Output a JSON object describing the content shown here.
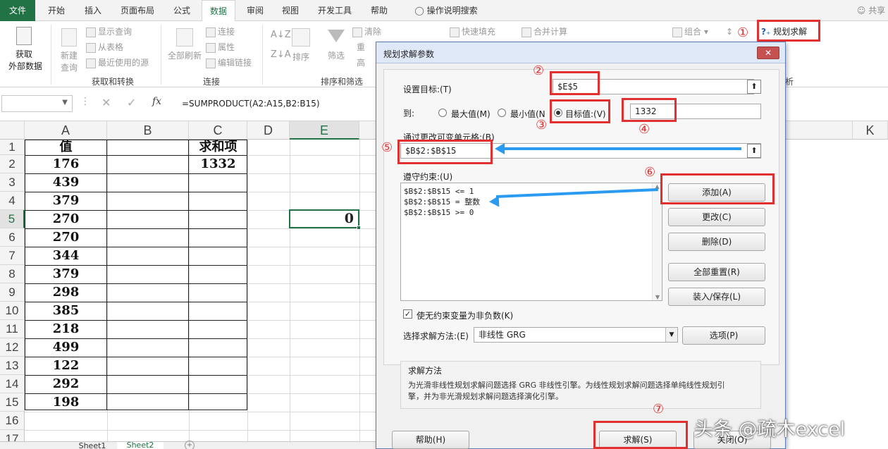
{
  "ribbon": {
    "tabs": [
      "文件",
      "开始",
      "插入",
      "页面布局",
      "公式",
      "数据",
      "审阅",
      "视图",
      "开发工具",
      "帮助",
      "操作说明搜索"
    ],
    "active_tab": "数据",
    "share": "共享",
    "get_external_data_1": "获取",
    "get_external_data_2": "外部数据",
    "new_query_1": "新建",
    "new_query_2": "查询",
    "show_queries": "显示查询",
    "from_table": "从表格",
    "recent_sources": "最近使用的源",
    "group_get_transform": "获取和转换",
    "refresh_all": "全部刷新",
    "connections": "连接",
    "properties": "属性",
    "edit_links": "编辑链接",
    "group_connections": "连接",
    "sort": "排序",
    "filter": "筛选",
    "clear": "清除",
    "reapply": "重",
    "advanced": "高",
    "group_sort_filter": "排序和筛选",
    "flash_fill": "快速填充",
    "consolidate": "合并计算",
    "group_outline": "组合",
    "solver": "规划求解",
    "analysis": "析"
  },
  "formula_bar": {
    "formula": "=SUMPRODUCT(A2:A15,B2:B15)"
  },
  "grid": {
    "columns": [
      "A",
      "B",
      "C",
      "D",
      "E",
      "K"
    ],
    "rows": [
      "1",
      "2",
      "3",
      "4",
      "5",
      "6",
      "7",
      "8",
      "9",
      "10",
      "11",
      "12",
      "13",
      "14",
      "15",
      "16",
      "17"
    ],
    "a_header": "值",
    "c_header": "求和项",
    "values": [
      "176",
      "439",
      "379",
      "270",
      "270",
      "344",
      "379",
      "298",
      "385",
      "218",
      "499",
      "122",
      "292",
      "198"
    ],
    "c2": "1332",
    "e5": "0"
  },
  "sheets": [
    "Sheet1",
    "Sheet2"
  ],
  "dialog": {
    "title": "规划求解参数",
    "set_objective_label": "设置目标:(T)",
    "set_objective_value": "$E$5",
    "to_label": "到:",
    "opt_max": "最大值(M)",
    "opt_min": "最小值(N",
    "opt_value": "目标值:(V)",
    "target_value": "1332",
    "changing_cells_label": "通过更改可变单元格:(B)",
    "changing_cells_value": "$B$2:$B$15",
    "constraints_label": "遵守约束:(U)",
    "constraints": [
      "$B$2:$B$15 <= 1",
      "$B$2:$B$15 = 整数",
      "$B$2:$B$15 >= 0"
    ],
    "btn_add": "添加(A)",
    "btn_change": "更改(C)",
    "btn_delete": "删除(D)",
    "btn_reset": "全部重置(R)",
    "btn_load_save": "装入/保存(L)",
    "nonneg_label": "使无约束变量为非负数(K)",
    "method_label": "选择求解方法:(E)",
    "method_value": "非线性 GRG",
    "btn_options": "选项(P)",
    "method_section_title": "求解方法",
    "method_desc_1": "为光滑非线性规划求解问题选择 GRG 非线性引擎。为线性规划求解问题选择单纯线性规划引",
    "method_desc_2": "擎，并为非光滑规划求解问题选择演化引擎。",
    "btn_help": "帮助(H)",
    "btn_solve": "求解(S)",
    "btn_close": "关闭(O)"
  },
  "annotations": {
    "m1": "①",
    "m2": "②",
    "m3": "③",
    "m4": "④",
    "m5": "⑤",
    "m6": "⑥",
    "m7": "⑦",
    "watermark": "头条 @疏木excel",
    "color_red": "#e03030",
    "color_arrow": "#2a9bf0"
  }
}
